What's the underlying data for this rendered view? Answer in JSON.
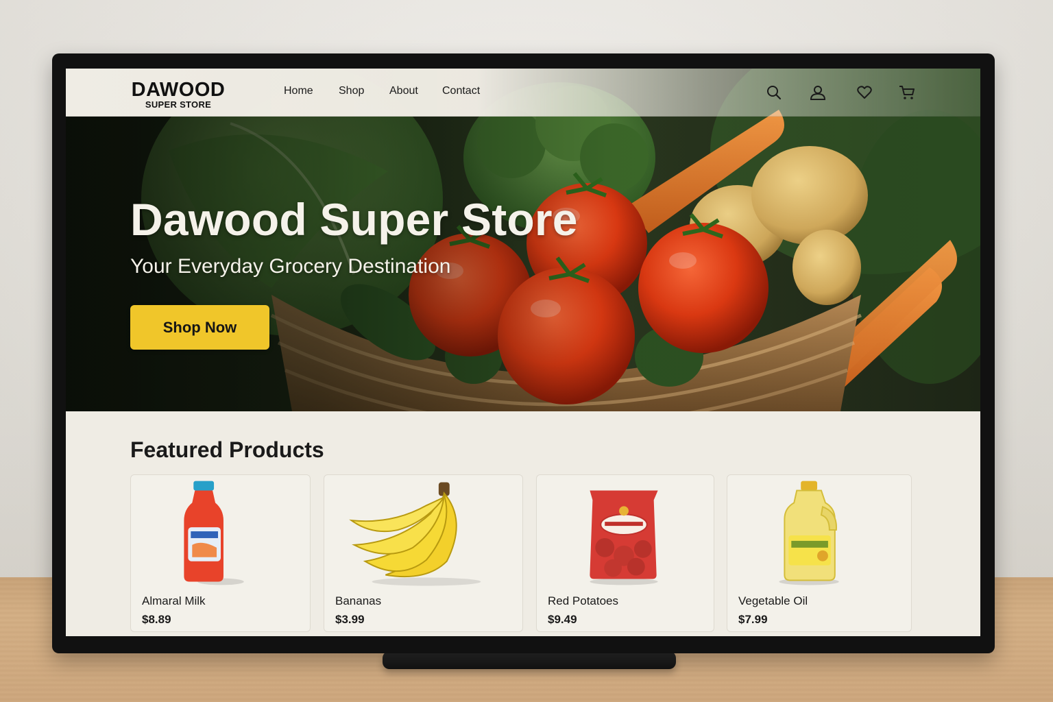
{
  "brand": {
    "name": "DAWOOD",
    "tagline": "SUPER STORE"
  },
  "nav": {
    "links": [
      {
        "label": "Home"
      },
      {
        "label": "Shop"
      },
      {
        "label": "About"
      },
      {
        "label": "Contact"
      }
    ],
    "icons": [
      "search-icon",
      "user-icon",
      "heart-icon",
      "cart-icon"
    ]
  },
  "hero": {
    "title": "Dawood Super Store",
    "subtitle": "Your Everyday Grocery Destination",
    "cta_label": "Shop Now"
  },
  "featured": {
    "title": "Featured Products",
    "products": [
      {
        "name": "Almaral Milk",
        "price": "$8.89",
        "image": "milk-bottle"
      },
      {
        "name": "Bananas",
        "price": "$3.99",
        "image": "bananas"
      },
      {
        "name": "Red Potatoes",
        "price": "$9.49",
        "image": "potato-bag"
      },
      {
        "name": "Vegetable Oil",
        "price": "$7.99",
        "image": "oil-jug"
      }
    ]
  },
  "colors": {
    "accent": "#f0c62a",
    "page_bg": "#efece4",
    "text": "#1a1a1a",
    "hero_text": "#f5f2ea"
  }
}
